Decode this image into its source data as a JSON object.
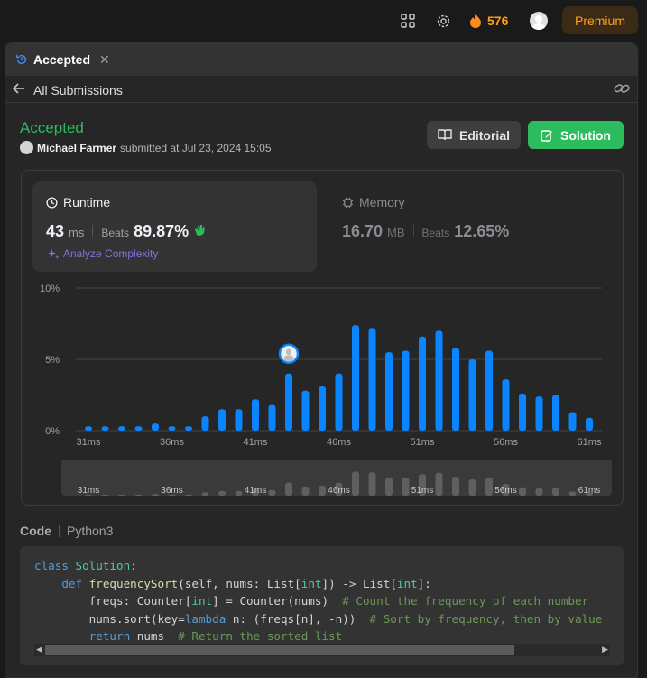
{
  "topbar": {
    "streak_count": "576",
    "premium_label": "Premium"
  },
  "tab": {
    "label": "Accepted"
  },
  "subbar": {
    "back_label": "All Submissions"
  },
  "submission": {
    "status": "Accepted",
    "user": "Michael Farmer",
    "submitted_text": "submitted at Jul 23, 2024 15:05",
    "editorial_label": "Editorial",
    "solution_label": "Solution"
  },
  "runtime": {
    "title": "Runtime",
    "value": "43",
    "unit": "ms",
    "beats_label": "Beats",
    "beats_value": "89.87%",
    "analyze_label": "Analyze Complexity"
  },
  "memory": {
    "title": "Memory",
    "value": "16.70",
    "unit": "MB",
    "beats_label": "Beats",
    "beats_value": "12.65%"
  },
  "code_section": {
    "label": "Code",
    "language": "Python3",
    "lines": [
      "class Solution:",
      "    def frequencySort(self, nums: List[int]) -> List[int]:",
      "        freqs: Counter[int] = Counter(nums)  # Count the frequency of each number",
      "        nums.sort(key=lambda n: (freqs[n], -n))  # Sort by frequency, then by value",
      "        return nums  # Return the sorted list"
    ]
  },
  "colors": {
    "accent_green": "#2cbb5d",
    "bar_blue": "#0a84ff",
    "premium_orange": "#ffa116"
  },
  "chart_data": {
    "type": "bar",
    "x_tick_labels": [
      "31ms",
      "36ms",
      "41ms",
      "46ms",
      "51ms",
      "56ms",
      "61ms"
    ],
    "y_tick_labels": [
      "0%",
      "5%",
      "10%"
    ],
    "ylim": [
      0,
      10
    ],
    "x": [
      31,
      32,
      33,
      34,
      35,
      36,
      37,
      38,
      39,
      40,
      41,
      42,
      43,
      44,
      45,
      46,
      47,
      48,
      49,
      50,
      51,
      52,
      53,
      54,
      55,
      56,
      57,
      58,
      59,
      60,
      61
    ],
    "values": [
      0.3,
      0.3,
      0.3,
      0.3,
      0.5,
      0.3,
      0.3,
      1.0,
      1.5,
      1.5,
      2.2,
      1.8,
      4.0,
      2.8,
      3.1,
      4.0,
      7.4,
      7.2,
      5.5,
      5.6,
      6.6,
      7.0,
      5.8,
      5.0,
      5.6,
      3.6,
      2.6,
      2.4,
      2.5,
      1.3,
      0.9
    ],
    "highlight_x": 43,
    "grid": true
  }
}
